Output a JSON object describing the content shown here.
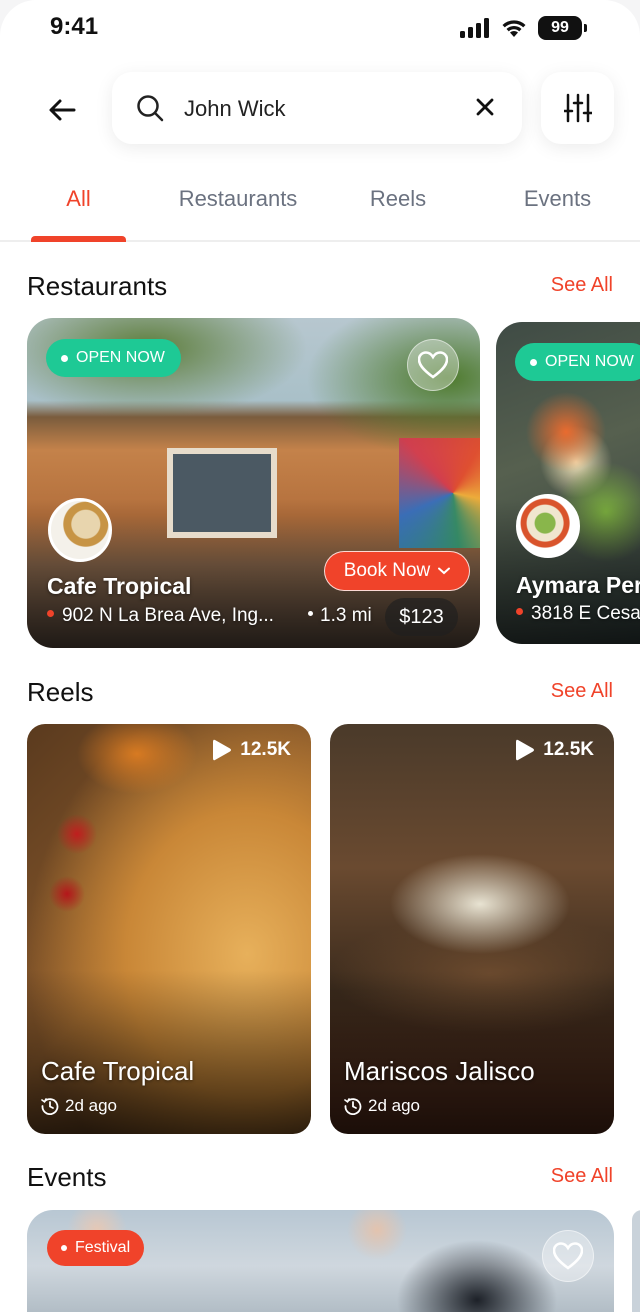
{
  "status_bar": {
    "time": "9:41",
    "battery": "99"
  },
  "search": {
    "value": "John Wick"
  },
  "tabs": [
    {
      "label": "All",
      "active": true
    },
    {
      "label": "Restaurants",
      "active": false
    },
    {
      "label": "Reels",
      "active": false
    },
    {
      "label": "Events",
      "active": false
    }
  ],
  "sections": {
    "restaurants": {
      "title": "Restaurants",
      "see_all": "See All"
    },
    "reels": {
      "title": "Reels",
      "see_all": "See All"
    },
    "events": {
      "title": "Events",
      "see_all": "See All"
    }
  },
  "restaurants": [
    {
      "status": "OPEN NOW",
      "name": "Cafe Tropical",
      "address": "902 N La Brea Ave, Ing...",
      "distance": "1.3 mi",
      "price": "$123",
      "book_label": "Book Now"
    },
    {
      "status": "OPEN NOW",
      "name": "Aymara Per",
      "address": "3818 E Cesa"
    }
  ],
  "reels": [
    {
      "views": "12.5K",
      "name": "Cafe Tropical",
      "time": "2d ago"
    },
    {
      "views": "12.5K",
      "name": "Mariscos Jalisco",
      "time": "2d ago"
    }
  ],
  "events": [
    {
      "tag": "Festival"
    }
  ],
  "colors": {
    "accent": "#f0432a",
    "open_green": "#1ec995"
  },
  "icons": {
    "back": "arrow-left-icon",
    "search": "search-icon",
    "clear": "close-icon",
    "filter": "sliders-icon",
    "favorite": "heart-icon",
    "play": "play-icon",
    "clock": "clock-icon",
    "chevron": "chevron-down-icon"
  }
}
